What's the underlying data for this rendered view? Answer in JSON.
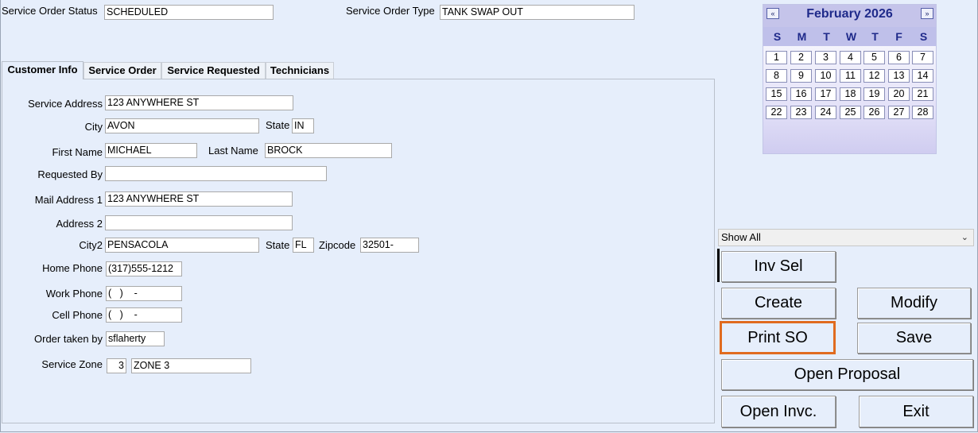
{
  "header": {
    "status_label": "Service Order Status",
    "status_value": "SCHEDULED",
    "type_label": "Service Order Type",
    "type_value": "TANK SWAP OUT"
  },
  "tabs": [
    {
      "label": "Customer Info",
      "active": true
    },
    {
      "label": "Service Order",
      "active": false
    },
    {
      "label": "Service Requested",
      "active": false
    },
    {
      "label": "Technicians",
      "active": false
    }
  ],
  "form": {
    "service_address_label": "Service Address",
    "service_address": "123 ANYWHERE ST",
    "city_label": "City",
    "city": "AVON",
    "state_label": "State",
    "state": "IN",
    "first_name_label": "First Name",
    "first_name": "MICHAEL",
    "last_name_label": "Last Name",
    "last_name": "BROCK",
    "requested_by_label": "Requested By",
    "requested_by": "",
    "mail_address1_label": "Mail Address 1",
    "mail_address1": "123 ANYWHERE ST",
    "address2_label": "Address 2",
    "address2": "",
    "city2_label": "City2",
    "city2": "PENSACOLA",
    "state2_label": "State",
    "state2": "FL",
    "zipcode_label": "Zipcode",
    "zipcode": "32501-",
    "home_phone_label": "Home Phone",
    "home_phone": "(317)555-1212",
    "work_phone_label": "Work Phone",
    "work_phone": "(   )    -",
    "cell_phone_label": "Cell Phone",
    "cell_phone": "(   )    -",
    "order_taken_by_label": "Order taken by",
    "order_taken_by": "sflaherty",
    "service_zone_label": "Service Zone",
    "service_zone_num": "3",
    "service_zone_name": "ZONE 3"
  },
  "calendar": {
    "title": "February 2026",
    "prev_icon": "«",
    "next_icon": "»",
    "days_of_week": [
      "S",
      "M",
      "T",
      "W",
      "T",
      "F",
      "S"
    ],
    "weeks": [
      [
        "1",
        "2",
        "3",
        "4",
        "5",
        "6",
        "7"
      ],
      [
        "8",
        "9",
        "10",
        "11",
        "12",
        "13",
        "14"
      ],
      [
        "15",
        "16",
        "17",
        "18",
        "19",
        "20",
        "21"
      ],
      [
        "22",
        "23",
        "24",
        "25",
        "26",
        "27",
        "28"
      ]
    ]
  },
  "filter": {
    "selected": "Show All",
    "icon": "chevron-down-icon"
  },
  "buttons": {
    "inv_sel": "Inv Sel",
    "create": "Create",
    "modify": "Modify",
    "print_so": "Print SO",
    "save": "Save",
    "open_proposal": "Open Proposal",
    "open_invc": "Open Invc.",
    "exit": "Exit"
  },
  "colors": {
    "background": "#e6eefb",
    "calendar_title": "#1f2a8a",
    "focus_border": "#e06b1f"
  }
}
